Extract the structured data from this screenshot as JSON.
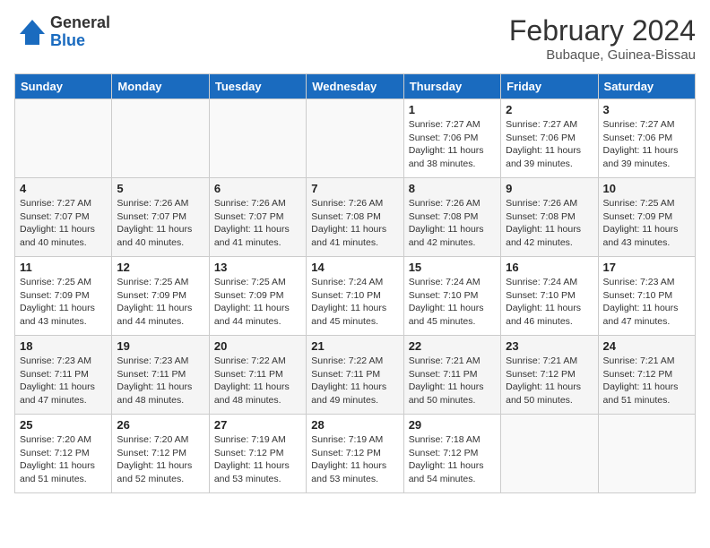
{
  "logo": {
    "general": "General",
    "blue": "Blue"
  },
  "title": "February 2024",
  "subtitle": "Bubaque, Guinea-Bissau",
  "days_of_week": [
    "Sunday",
    "Monday",
    "Tuesday",
    "Wednesday",
    "Thursday",
    "Friday",
    "Saturday"
  ],
  "weeks": [
    [
      {
        "day": "",
        "sunrise": "",
        "sunset": "",
        "daylight": ""
      },
      {
        "day": "",
        "sunrise": "",
        "sunset": "",
        "daylight": ""
      },
      {
        "day": "",
        "sunrise": "",
        "sunset": "",
        "daylight": ""
      },
      {
        "day": "",
        "sunrise": "",
        "sunset": "",
        "daylight": ""
      },
      {
        "day": "1",
        "sunrise": "Sunrise: 7:27 AM",
        "sunset": "Sunset: 7:06 PM",
        "daylight": "Daylight: 11 hours and 38 minutes."
      },
      {
        "day": "2",
        "sunrise": "Sunrise: 7:27 AM",
        "sunset": "Sunset: 7:06 PM",
        "daylight": "Daylight: 11 hours and 39 minutes."
      },
      {
        "day": "3",
        "sunrise": "Sunrise: 7:27 AM",
        "sunset": "Sunset: 7:06 PM",
        "daylight": "Daylight: 11 hours and 39 minutes."
      }
    ],
    [
      {
        "day": "4",
        "sunrise": "Sunrise: 7:27 AM",
        "sunset": "Sunset: 7:07 PM",
        "daylight": "Daylight: 11 hours and 40 minutes."
      },
      {
        "day": "5",
        "sunrise": "Sunrise: 7:26 AM",
        "sunset": "Sunset: 7:07 PM",
        "daylight": "Daylight: 11 hours and 40 minutes."
      },
      {
        "day": "6",
        "sunrise": "Sunrise: 7:26 AM",
        "sunset": "Sunset: 7:07 PM",
        "daylight": "Daylight: 11 hours and 41 minutes."
      },
      {
        "day": "7",
        "sunrise": "Sunrise: 7:26 AM",
        "sunset": "Sunset: 7:08 PM",
        "daylight": "Daylight: 11 hours and 41 minutes."
      },
      {
        "day": "8",
        "sunrise": "Sunrise: 7:26 AM",
        "sunset": "Sunset: 7:08 PM",
        "daylight": "Daylight: 11 hours and 42 minutes."
      },
      {
        "day": "9",
        "sunrise": "Sunrise: 7:26 AM",
        "sunset": "Sunset: 7:08 PM",
        "daylight": "Daylight: 11 hours and 42 minutes."
      },
      {
        "day": "10",
        "sunrise": "Sunrise: 7:25 AM",
        "sunset": "Sunset: 7:09 PM",
        "daylight": "Daylight: 11 hours and 43 minutes."
      }
    ],
    [
      {
        "day": "11",
        "sunrise": "Sunrise: 7:25 AM",
        "sunset": "Sunset: 7:09 PM",
        "daylight": "Daylight: 11 hours and 43 minutes."
      },
      {
        "day": "12",
        "sunrise": "Sunrise: 7:25 AM",
        "sunset": "Sunset: 7:09 PM",
        "daylight": "Daylight: 11 hours and 44 minutes."
      },
      {
        "day": "13",
        "sunrise": "Sunrise: 7:25 AM",
        "sunset": "Sunset: 7:09 PM",
        "daylight": "Daylight: 11 hours and 44 minutes."
      },
      {
        "day": "14",
        "sunrise": "Sunrise: 7:24 AM",
        "sunset": "Sunset: 7:10 PM",
        "daylight": "Daylight: 11 hours and 45 minutes."
      },
      {
        "day": "15",
        "sunrise": "Sunrise: 7:24 AM",
        "sunset": "Sunset: 7:10 PM",
        "daylight": "Daylight: 11 hours and 45 minutes."
      },
      {
        "day": "16",
        "sunrise": "Sunrise: 7:24 AM",
        "sunset": "Sunset: 7:10 PM",
        "daylight": "Daylight: 11 hours and 46 minutes."
      },
      {
        "day": "17",
        "sunrise": "Sunrise: 7:23 AM",
        "sunset": "Sunset: 7:10 PM",
        "daylight": "Daylight: 11 hours and 47 minutes."
      }
    ],
    [
      {
        "day": "18",
        "sunrise": "Sunrise: 7:23 AM",
        "sunset": "Sunset: 7:11 PM",
        "daylight": "Daylight: 11 hours and 47 minutes."
      },
      {
        "day": "19",
        "sunrise": "Sunrise: 7:23 AM",
        "sunset": "Sunset: 7:11 PM",
        "daylight": "Daylight: 11 hours and 48 minutes."
      },
      {
        "day": "20",
        "sunrise": "Sunrise: 7:22 AM",
        "sunset": "Sunset: 7:11 PM",
        "daylight": "Daylight: 11 hours and 48 minutes."
      },
      {
        "day": "21",
        "sunrise": "Sunrise: 7:22 AM",
        "sunset": "Sunset: 7:11 PM",
        "daylight": "Daylight: 11 hours and 49 minutes."
      },
      {
        "day": "22",
        "sunrise": "Sunrise: 7:21 AM",
        "sunset": "Sunset: 7:11 PM",
        "daylight": "Daylight: 11 hours and 50 minutes."
      },
      {
        "day": "23",
        "sunrise": "Sunrise: 7:21 AM",
        "sunset": "Sunset: 7:12 PM",
        "daylight": "Daylight: 11 hours and 50 minutes."
      },
      {
        "day": "24",
        "sunrise": "Sunrise: 7:21 AM",
        "sunset": "Sunset: 7:12 PM",
        "daylight": "Daylight: 11 hours and 51 minutes."
      }
    ],
    [
      {
        "day": "25",
        "sunrise": "Sunrise: 7:20 AM",
        "sunset": "Sunset: 7:12 PM",
        "daylight": "Daylight: 11 hours and 51 minutes."
      },
      {
        "day": "26",
        "sunrise": "Sunrise: 7:20 AM",
        "sunset": "Sunset: 7:12 PM",
        "daylight": "Daylight: 11 hours and 52 minutes."
      },
      {
        "day": "27",
        "sunrise": "Sunrise: 7:19 AM",
        "sunset": "Sunset: 7:12 PM",
        "daylight": "Daylight: 11 hours and 53 minutes."
      },
      {
        "day": "28",
        "sunrise": "Sunrise: 7:19 AM",
        "sunset": "Sunset: 7:12 PM",
        "daylight": "Daylight: 11 hours and 53 minutes."
      },
      {
        "day": "29",
        "sunrise": "Sunrise: 7:18 AM",
        "sunset": "Sunset: 7:12 PM",
        "daylight": "Daylight: 11 hours and 54 minutes."
      },
      {
        "day": "",
        "sunrise": "",
        "sunset": "",
        "daylight": ""
      },
      {
        "day": "",
        "sunrise": "",
        "sunset": "",
        "daylight": ""
      }
    ]
  ]
}
